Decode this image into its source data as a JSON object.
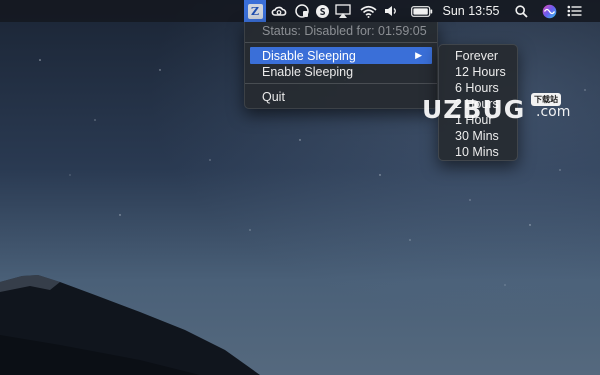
{
  "menubar": {
    "app_icon_letter": "Z",
    "icons": [
      "app-icon",
      "creative-cloud-icon",
      "lock-icon",
      "skype-icon",
      "airplay-icon",
      "wifi-icon",
      "volume-icon",
      "battery-icon",
      "search-icon",
      "siri-icon",
      "notification-center-icon"
    ],
    "clock": "Sun 13:55"
  },
  "menu": {
    "status": "Status: Disabled for: 01:59:05",
    "items": [
      {
        "label": "Disable Sleeping",
        "submenu_arrow": "▶"
      },
      {
        "label": "Enable Sleeping"
      },
      {
        "label": "Quit"
      }
    ]
  },
  "submenu": {
    "items": [
      "Forever",
      "12 Hours",
      "6 Hours",
      "2 Hours",
      "1 Hour",
      "30 Mins",
      "10 Mins"
    ]
  },
  "watermark": {
    "brand": "UZBUG",
    "domain": ".com",
    "badge": "下载站"
  },
  "colors": {
    "highlight": "#3a6fd8",
    "menu_bg": "#26292f",
    "sky_top": "#1d2737"
  }
}
